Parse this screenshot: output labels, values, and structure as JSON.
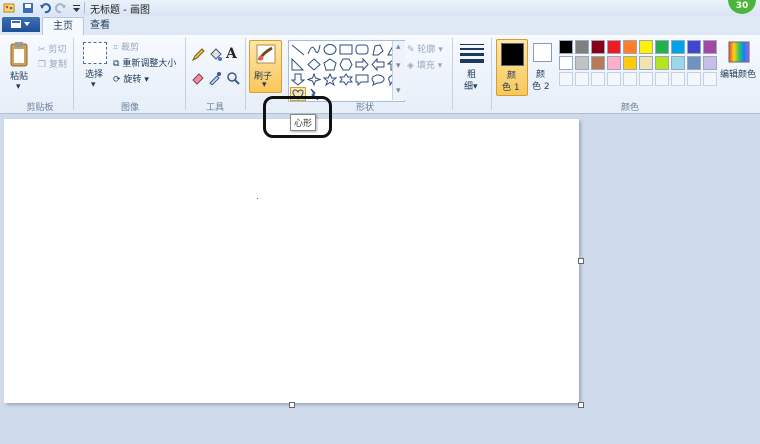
{
  "titlebar": {
    "title": "无标题 - 画图"
  },
  "account_badge": {
    "text": "30"
  },
  "tabs": [
    {
      "label": "主页"
    },
    {
      "label": "查看"
    }
  ],
  "ribbon": {
    "clipboard": {
      "paste": "粘贴",
      "cut": "剪切",
      "copy": "复制",
      "group_label": "剪贴板"
    },
    "image": {
      "select": "选择",
      "crop": "裁剪",
      "resize": "重新调整大小",
      "rotate": "旋转",
      "group_label": "图像"
    },
    "tools": {
      "group_label": "工具"
    },
    "brushes": {
      "label": "刷子"
    },
    "shapes": {
      "outline": "轮廓",
      "fill": "填充",
      "group_label": "形状"
    },
    "size": {
      "label_1": "粗",
      "label_2": "细"
    },
    "colors": {
      "color1_label_1": "颜",
      "color1_label_2": "色 1",
      "color2_label_1": "颜",
      "color2_label_2": "色 2",
      "edit_colors": "编辑颜色",
      "group_label": "颜色",
      "palette_row1": [
        "#000000",
        "#7f7f7f",
        "#880015",
        "#ed1c24",
        "#ff7f27",
        "#fff200",
        "#22b14c",
        "#00a2e8",
        "#3f48cc",
        "#a349a4"
      ],
      "palette_row2": [
        "#ffffff",
        "#c3c3c3",
        "#b97a57",
        "#ffaec9",
        "#ffc90e",
        "#efe4b0",
        "#b5e61d",
        "#99d9ea",
        "#7092be",
        "#c8bfe7"
      ]
    }
  },
  "tooltip": {
    "text": "心形"
  }
}
